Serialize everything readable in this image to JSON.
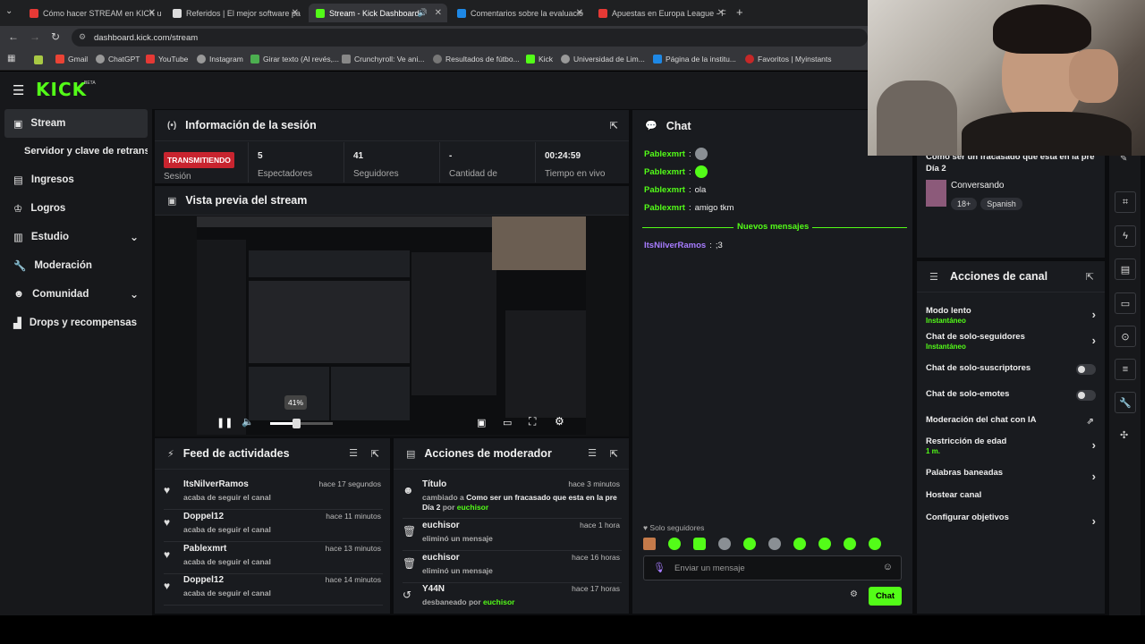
{
  "browser": {
    "tabs": [
      {
        "label": "Cómo hacer STREAM en KICK u",
        "color": "#e53935"
      },
      {
        "label": "Referidos | El mejor software pa",
        "color": "#ffffff"
      },
      {
        "label": "Stream - Kick Dashboard",
        "color": "#53fc18"
      },
      {
        "label": "Comentarios sobre la evaluació",
        "color": "#1e88e5"
      },
      {
        "label": "Apuestas en Europa League - F",
        "color": "#e53935"
      }
    ],
    "url": "dashboard.kick.com/stream",
    "bookmarks": [
      "Gmail",
      "ChatGPT",
      "YouTube",
      "Instagram",
      "Girar texto (Al revés,...",
      "Crunchyroll: Ve ani...",
      "Resultados de fútbo...",
      "Kick",
      "Universidad de Lim...",
      "Página de la institu...",
      "Favoritos | Myinstants"
    ]
  },
  "logo": {
    "text": "KICK",
    "beta": "BETA"
  },
  "sidebar": {
    "items": [
      {
        "label": "Stream",
        "icon": "broadcast-icon"
      },
      {
        "label": "Servidor y clave de retransm",
        "icon": ""
      },
      {
        "label": "Ingresos",
        "icon": "wallet-icon"
      },
      {
        "label": "Logros",
        "icon": "trophy-icon"
      },
      {
        "label": "Estudio",
        "icon": "studio-icon"
      },
      {
        "label": "Moderación",
        "icon": "wrench-icon"
      },
      {
        "label": "Comunidad",
        "icon": "people-icon"
      },
      {
        "label": "Drops y recompensas",
        "icon": "chart-icon"
      }
    ]
  },
  "session": {
    "title": "Información de la sesión",
    "status": "TRANSMITIENDO",
    "status_label": "Sesión",
    "stats": [
      {
        "value": "5",
        "label": "Espectadores"
      },
      {
        "value": "41",
        "label": "Seguidores"
      },
      {
        "value": "-",
        "label": "Cantidad de"
      },
      {
        "value": "00:24:59",
        "label": "Tiempo en vivo"
      }
    ]
  },
  "preview": {
    "title": "Vista previa del stream",
    "volume_badge": "41%",
    "volume_level": 0.41
  },
  "feed": {
    "title": "Feed de actividades",
    "rows": [
      {
        "name": "ItsNilverRamos",
        "sub": "acaba de seguir el canal",
        "time": "hace 17 segundos"
      },
      {
        "name": "Doppel12",
        "sub": "acaba de seguir el canal",
        "time": "hace 11 minutos"
      },
      {
        "name": "Pablexmrt",
        "sub": "acaba de seguir el canal",
        "time": "hace 13 minutos"
      },
      {
        "name": "Doppel12",
        "sub": "acaba de seguir el canal",
        "time": "hace 14 minutos"
      }
    ]
  },
  "modactions": {
    "title": "Acciones de moderador",
    "rows": [
      {
        "name": "Título",
        "line1": "cambiado a ",
        "bold": "Como ser un fracasado que esta en la pre",
        "line2": "Día 2",
        "por": " por ",
        "user": "euchisor",
        "time": "hace 3 minutos"
      },
      {
        "name": "euchisor",
        "sub": "eliminó un mensaje",
        "time": "hace 1 hora"
      },
      {
        "name": "euchisor",
        "sub": "eliminó un mensaje",
        "time": "hace 16 horas"
      },
      {
        "name": "Y44N",
        "sub": "desbaneado por ",
        "user": "euchisor",
        "time": "hace 17 horas"
      }
    ]
  },
  "chat": {
    "title": "Chat",
    "messages": [
      {
        "user": "Pablexmrt",
        "text": ""
      },
      {
        "user": "Pablexmrt",
        "text": ""
      },
      {
        "user": "Pablexmrt",
        "text": "ola"
      },
      {
        "user": "Pablexmrt",
        "text": "amigo tkm"
      }
    ],
    "new_label": "Nuevos mensajes",
    "new_msg_user": "ItsNilverRamos",
    "new_msg_text": ";3",
    "followers_only": "Solo seguidores",
    "input_placeholder": "Enviar un mensaje",
    "send_label": "Chat"
  },
  "stream_info": {
    "title_line1": "Como ser un fracasado que esta en la pre",
    "title_line2": "Día 2",
    "category": "Conversando",
    "tags": [
      "18+",
      "Spanish"
    ]
  },
  "channel_actions": {
    "title": "Acciones de canal",
    "items": [
      {
        "label": "Modo lento",
        "sub": "Instantáneo",
        "kind": "arrow"
      },
      {
        "label": "Chat de solo-seguidores",
        "sub": "Instantáneo",
        "kind": "arrow"
      },
      {
        "label": "Chat de solo-suscriptores",
        "sub": "",
        "kind": "toggle"
      },
      {
        "label": "Chat de solo-emotes",
        "sub": "",
        "kind": "toggle"
      },
      {
        "label": "Moderación del chat con IA",
        "sub": "",
        "kind": "external"
      },
      {
        "label": "Restricción de edad",
        "sub": "1 m.",
        "kind": "arrow"
      },
      {
        "label": "Palabras baneadas",
        "sub": "",
        "kind": "arrow"
      },
      {
        "label": "Hostear canal",
        "sub": "",
        "kind": "none"
      },
      {
        "label": "Configurar objetivos",
        "sub": "",
        "kind": "arrow"
      }
    ]
  },
  "colors": {
    "accent": "#53fc18",
    "live": "#c8242f",
    "panel": "#191b1f"
  }
}
